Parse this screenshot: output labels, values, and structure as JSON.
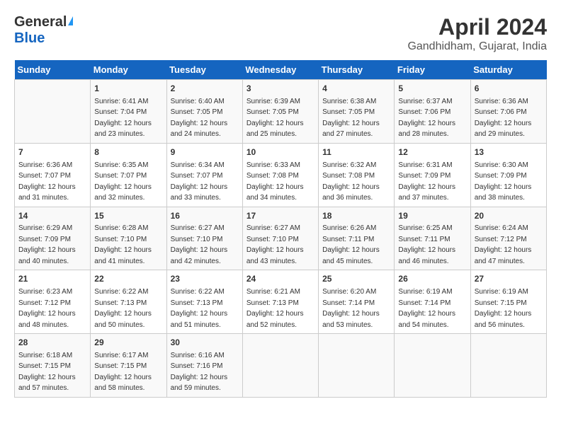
{
  "logo": {
    "line1": "General",
    "line2": "Blue"
  },
  "title": "April 2024",
  "subtitle": "Gandhidham, Gujarat, India",
  "days_header": [
    "Sunday",
    "Monday",
    "Tuesday",
    "Wednesday",
    "Thursday",
    "Friday",
    "Saturday"
  ],
  "weeks": [
    [
      {
        "num": "",
        "sunrise": "",
        "sunset": "",
        "daylight": ""
      },
      {
        "num": "1",
        "sunrise": "Sunrise: 6:41 AM",
        "sunset": "Sunset: 7:04 PM",
        "daylight": "Daylight: 12 hours and 23 minutes."
      },
      {
        "num": "2",
        "sunrise": "Sunrise: 6:40 AM",
        "sunset": "Sunset: 7:05 PM",
        "daylight": "Daylight: 12 hours and 24 minutes."
      },
      {
        "num": "3",
        "sunrise": "Sunrise: 6:39 AM",
        "sunset": "Sunset: 7:05 PM",
        "daylight": "Daylight: 12 hours and 25 minutes."
      },
      {
        "num": "4",
        "sunrise": "Sunrise: 6:38 AM",
        "sunset": "Sunset: 7:05 PM",
        "daylight": "Daylight: 12 hours and 27 minutes."
      },
      {
        "num": "5",
        "sunrise": "Sunrise: 6:37 AM",
        "sunset": "Sunset: 7:06 PM",
        "daylight": "Daylight: 12 hours and 28 minutes."
      },
      {
        "num": "6",
        "sunrise": "Sunrise: 6:36 AM",
        "sunset": "Sunset: 7:06 PM",
        "daylight": "Daylight: 12 hours and 29 minutes."
      }
    ],
    [
      {
        "num": "7",
        "sunrise": "Sunrise: 6:36 AM",
        "sunset": "Sunset: 7:07 PM",
        "daylight": "Daylight: 12 hours and 31 minutes."
      },
      {
        "num": "8",
        "sunrise": "Sunrise: 6:35 AM",
        "sunset": "Sunset: 7:07 PM",
        "daylight": "Daylight: 12 hours and 32 minutes."
      },
      {
        "num": "9",
        "sunrise": "Sunrise: 6:34 AM",
        "sunset": "Sunset: 7:07 PM",
        "daylight": "Daylight: 12 hours and 33 minutes."
      },
      {
        "num": "10",
        "sunrise": "Sunrise: 6:33 AM",
        "sunset": "Sunset: 7:08 PM",
        "daylight": "Daylight: 12 hours and 34 minutes."
      },
      {
        "num": "11",
        "sunrise": "Sunrise: 6:32 AM",
        "sunset": "Sunset: 7:08 PM",
        "daylight": "Daylight: 12 hours and 36 minutes."
      },
      {
        "num": "12",
        "sunrise": "Sunrise: 6:31 AM",
        "sunset": "Sunset: 7:09 PM",
        "daylight": "Daylight: 12 hours and 37 minutes."
      },
      {
        "num": "13",
        "sunrise": "Sunrise: 6:30 AM",
        "sunset": "Sunset: 7:09 PM",
        "daylight": "Daylight: 12 hours and 38 minutes."
      }
    ],
    [
      {
        "num": "14",
        "sunrise": "Sunrise: 6:29 AM",
        "sunset": "Sunset: 7:09 PM",
        "daylight": "Daylight: 12 hours and 40 minutes."
      },
      {
        "num": "15",
        "sunrise": "Sunrise: 6:28 AM",
        "sunset": "Sunset: 7:10 PM",
        "daylight": "Daylight: 12 hours and 41 minutes."
      },
      {
        "num": "16",
        "sunrise": "Sunrise: 6:27 AM",
        "sunset": "Sunset: 7:10 PM",
        "daylight": "Daylight: 12 hours and 42 minutes."
      },
      {
        "num": "17",
        "sunrise": "Sunrise: 6:27 AM",
        "sunset": "Sunset: 7:10 PM",
        "daylight": "Daylight: 12 hours and 43 minutes."
      },
      {
        "num": "18",
        "sunrise": "Sunrise: 6:26 AM",
        "sunset": "Sunset: 7:11 PM",
        "daylight": "Daylight: 12 hours and 45 minutes."
      },
      {
        "num": "19",
        "sunrise": "Sunrise: 6:25 AM",
        "sunset": "Sunset: 7:11 PM",
        "daylight": "Daylight: 12 hours and 46 minutes."
      },
      {
        "num": "20",
        "sunrise": "Sunrise: 6:24 AM",
        "sunset": "Sunset: 7:12 PM",
        "daylight": "Daylight: 12 hours and 47 minutes."
      }
    ],
    [
      {
        "num": "21",
        "sunrise": "Sunrise: 6:23 AM",
        "sunset": "Sunset: 7:12 PM",
        "daylight": "Daylight: 12 hours and 48 minutes."
      },
      {
        "num": "22",
        "sunrise": "Sunrise: 6:22 AM",
        "sunset": "Sunset: 7:13 PM",
        "daylight": "Daylight: 12 hours and 50 minutes."
      },
      {
        "num": "23",
        "sunrise": "Sunrise: 6:22 AM",
        "sunset": "Sunset: 7:13 PM",
        "daylight": "Daylight: 12 hours and 51 minutes."
      },
      {
        "num": "24",
        "sunrise": "Sunrise: 6:21 AM",
        "sunset": "Sunset: 7:13 PM",
        "daylight": "Daylight: 12 hours and 52 minutes."
      },
      {
        "num": "25",
        "sunrise": "Sunrise: 6:20 AM",
        "sunset": "Sunset: 7:14 PM",
        "daylight": "Daylight: 12 hours and 53 minutes."
      },
      {
        "num": "26",
        "sunrise": "Sunrise: 6:19 AM",
        "sunset": "Sunset: 7:14 PM",
        "daylight": "Daylight: 12 hours and 54 minutes."
      },
      {
        "num": "27",
        "sunrise": "Sunrise: 6:19 AM",
        "sunset": "Sunset: 7:15 PM",
        "daylight": "Daylight: 12 hours and 56 minutes."
      }
    ],
    [
      {
        "num": "28",
        "sunrise": "Sunrise: 6:18 AM",
        "sunset": "Sunset: 7:15 PM",
        "daylight": "Daylight: 12 hours and 57 minutes."
      },
      {
        "num": "29",
        "sunrise": "Sunrise: 6:17 AM",
        "sunset": "Sunset: 7:15 PM",
        "daylight": "Daylight: 12 hours and 58 minutes."
      },
      {
        "num": "30",
        "sunrise": "Sunrise: 6:16 AM",
        "sunset": "Sunset: 7:16 PM",
        "daylight": "Daylight: 12 hours and 59 minutes."
      },
      {
        "num": "",
        "sunrise": "",
        "sunset": "",
        "daylight": ""
      },
      {
        "num": "",
        "sunrise": "",
        "sunset": "",
        "daylight": ""
      },
      {
        "num": "",
        "sunrise": "",
        "sunset": "",
        "daylight": ""
      },
      {
        "num": "",
        "sunrise": "",
        "sunset": "",
        "daylight": ""
      }
    ]
  ]
}
